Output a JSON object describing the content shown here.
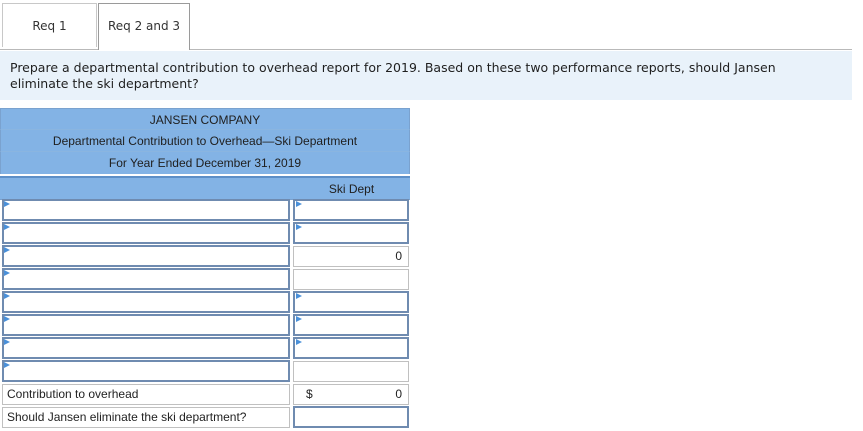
{
  "tabs": [
    {
      "label": "Req 1",
      "active": false
    },
    {
      "label": "Req 2 and 3",
      "active": true
    }
  ],
  "prompt": {
    "line1": "Prepare a departmental contribution to overhead report for 2019. Based on these two performance reports, should Jansen",
    "line2": "eliminate the ski department?"
  },
  "report": {
    "company": "JANSEN COMPANY",
    "title": "Departmental Contribution to Overhead—Ski Department",
    "period": "For Year Ended December 31, 2019",
    "column_header": "Ski Dept",
    "rows": [
      {
        "label": "",
        "value": ""
      },
      {
        "label": "",
        "value": ""
      },
      {
        "label": "",
        "value": "0"
      },
      {
        "label": "",
        "value": ""
      },
      {
        "label": "",
        "value": ""
      },
      {
        "label": "",
        "value": ""
      },
      {
        "label": "",
        "value": ""
      },
      {
        "label": "",
        "value": ""
      }
    ],
    "contribution_label": "Contribution to overhead",
    "contribution_currency": "$",
    "contribution_value": "0",
    "eliminate_label": "Should Jansen eliminate the ski department?",
    "eliminate_value": ""
  },
  "colors": {
    "header_bg": "#83b3e5",
    "prompt_bg": "#e9f2fa",
    "input_flag": "#4a90d9"
  }
}
